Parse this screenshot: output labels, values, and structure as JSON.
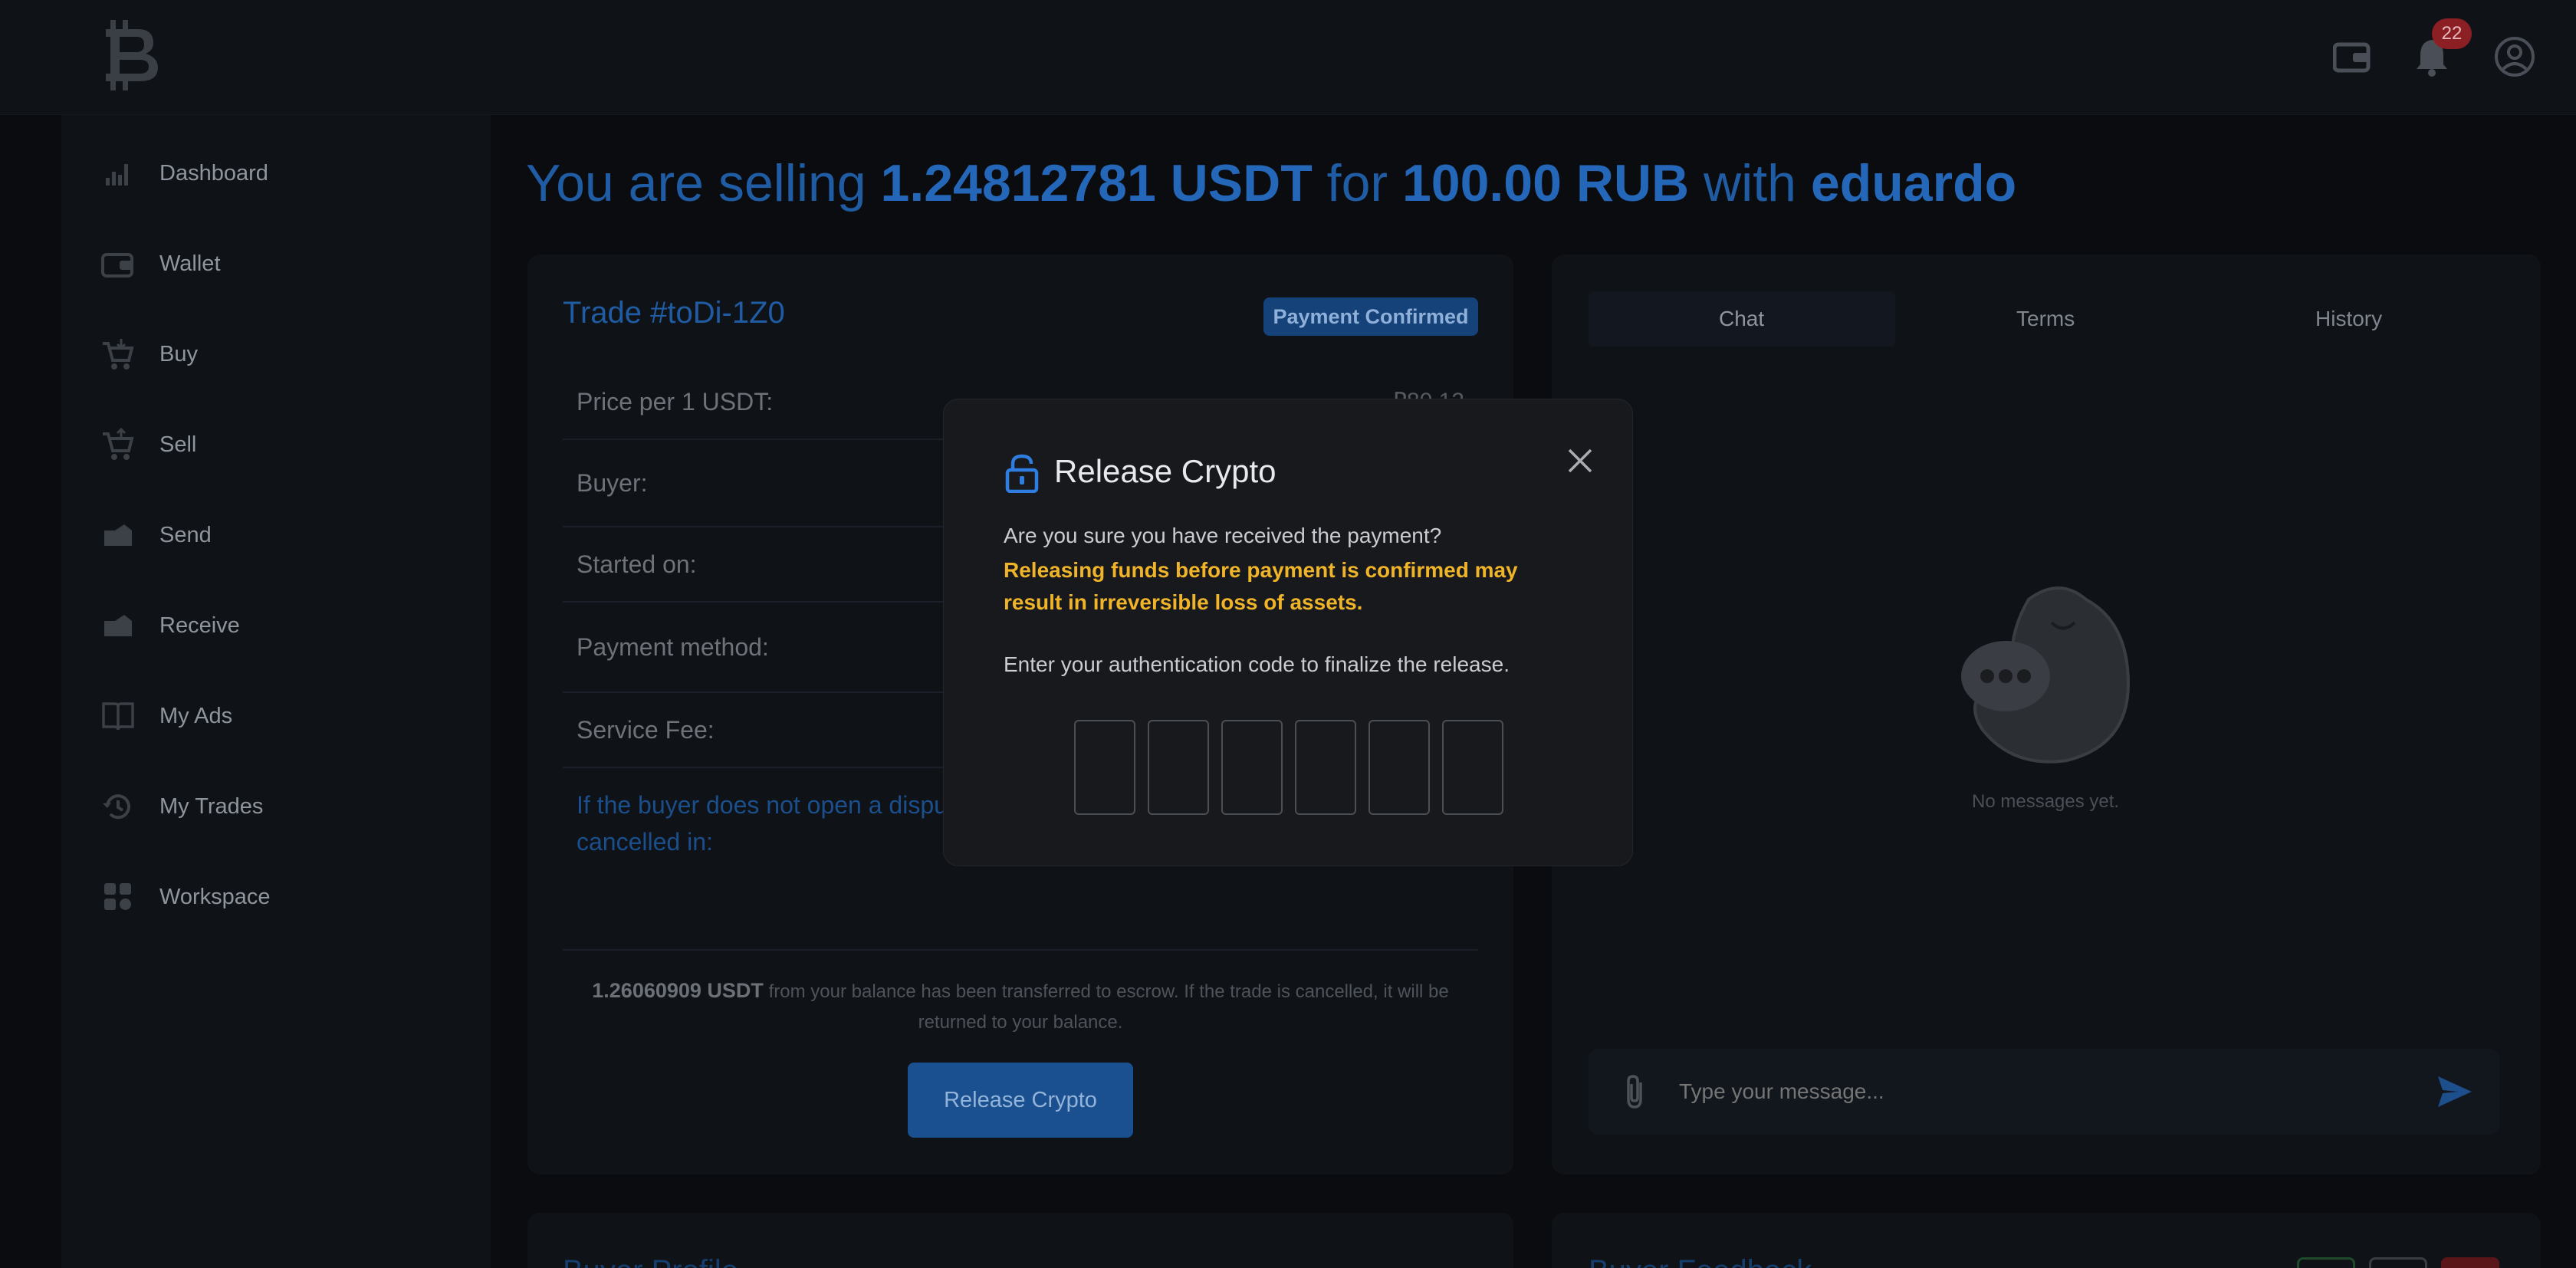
{
  "topbar": {
    "logo_icon": "bitcoin-logo-icon",
    "wallet_icon": "wallet-icon",
    "bell_icon": "bell-icon",
    "notification_count": "22",
    "profile_icon": "user-circle-icon"
  },
  "sidebar": {
    "items": [
      {
        "label": "Dashboard",
        "icon": "bar-chart-icon"
      },
      {
        "label": "Wallet",
        "icon": "wallet-icon"
      },
      {
        "label": "Buy",
        "icon": "cart-in-icon"
      },
      {
        "label": "Sell",
        "icon": "cart-out-icon"
      },
      {
        "label": "Send",
        "icon": "send-hand-icon"
      },
      {
        "label": "Receive",
        "icon": "receive-hand-icon"
      },
      {
        "label": "My Ads",
        "icon": "book-icon"
      },
      {
        "label": "My Trades",
        "icon": "history-icon"
      },
      {
        "label": "Workspace",
        "icon": "grid-icon"
      }
    ]
  },
  "headline": {
    "prefix": "You are selling",
    "amount": "1.24812781 USDT",
    "for_word": "for",
    "fiat": "100.00 RUB",
    "with_word": "with",
    "counterparty": "eduardo"
  },
  "trade": {
    "title": "Trade #toDi-1Z0",
    "status": "Payment Confirmed",
    "rows": [
      {
        "label": "Price per 1 USDT:",
        "value": "₽80.12"
      },
      {
        "label": "Buyer:",
        "value": ""
      },
      {
        "label": "Started on:",
        "value": ""
      },
      {
        "label": "Payment method:",
        "value": ""
      },
      {
        "label": "Service Fee:",
        "value": ""
      }
    ],
    "notice": "If the buyer does not open a dispute cancelled in:",
    "escrow_amount": "1.26060909 USDT",
    "escrow_text": "from your balance has been transferred to escrow. If the trade is cancelled, it will be returned to your balance.",
    "release_button": "Release Crypto"
  },
  "chat": {
    "tabs": [
      "Chat",
      "Terms",
      "History"
    ],
    "active_tab": "Chat",
    "empty_text": "No messages yet.",
    "placeholder": "Type your message...",
    "attach_icon": "paperclip-icon",
    "send_icon": "send-arrow-icon"
  },
  "bottom": {
    "left_title": "Buyer Profile",
    "right_title": "Buyer Feedback"
  },
  "modal": {
    "title": "Release Crypto",
    "lock_icon": "lock-icon",
    "close_icon": "close-icon",
    "question": "Are you sure you have received the payment?",
    "warning": "Releasing funds before payment is confirmed may result in irreversible loss of assets.",
    "instruction": "Enter your authentication code to finalize the release.",
    "code_digits": [
      "",
      "",
      "",
      "",
      "",
      ""
    ]
  },
  "colors": {
    "accent": "#1f5ca3",
    "warning": "#f0b429",
    "badge": "#8c1f23"
  }
}
